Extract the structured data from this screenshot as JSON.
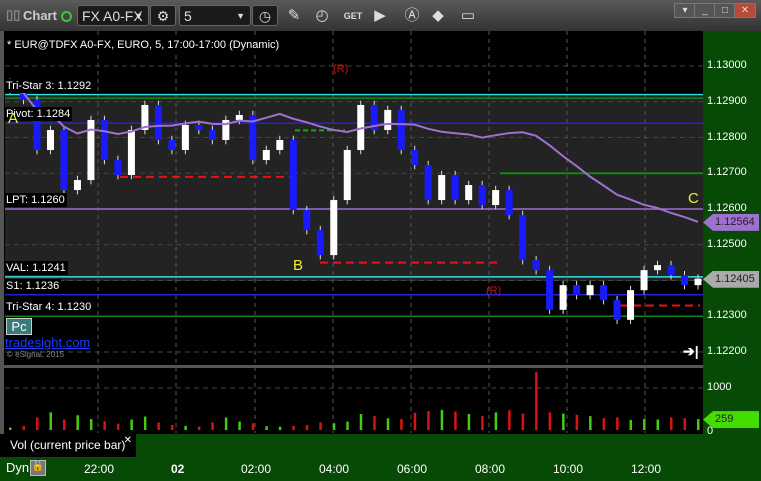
{
  "window": {
    "title": "Chart",
    "symbol": "FX A0-FX",
    "interval": "5"
  },
  "chart": {
    "header": "* EUR@TDFX A0-FX, EURO, 5, 17:00-17:00 (Dynamic)",
    "levels": [
      {
        "label": "Tri-Star 3: 1.1292",
        "price": 1.1292,
        "color": "#33e0e0"
      },
      {
        "label": "Pivot: 1.1284",
        "price": 1.1284,
        "color": "#2222dd"
      },
      {
        "label": "LPT: 1.1260",
        "price": 1.126,
        "color": "#9a6fd0"
      },
      {
        "label": "VAL: 1.1241",
        "price": 1.1241,
        "color": "#33e0e0"
      },
      {
        "label": "S1: 1.1236",
        "price": 1.1236,
        "color": "#2222dd"
      },
      {
        "label": "Tri-Star 4: 1.1230",
        "price": 1.123,
        "color": "#118811"
      }
    ],
    "pc_button": "Pc",
    "brand": "tradesight.com",
    "copyright": "© eSignal, 2015",
    "annotations": [
      "A",
      "B",
      "C",
      "(R)",
      "(R)"
    ],
    "closes": [
      1.12933,
      1.12905,
      1.12765,
      1.12821,
      1.12653,
      1.12681,
      1.12849,
      1.12737,
      1.12695,
      1.12821,
      1.12891,
      1.12793,
      1.12765,
      1.12835,
      1.12821,
      1.12793,
      1.12849,
      1.12863,
      1.12737,
      1.12765,
      1.12793,
      1.12597,
      1.12541,
      1.12471,
      1.12625,
      1.12765,
      1.12891,
      1.12821,
      1.12877,
      1.12765,
      1.12723,
      1.12625,
      1.12695,
      1.12625,
      1.12667,
      1.12611,
      1.12653,
      1.12583,
      1.12457,
      1.12429,
      1.12318,
      1.12387,
      1.12359,
      1.12387,
      1.12345,
      1.1229,
      1.12373,
      1.12429,
      1.12443,
      1.12415,
      1.12387,
      1.12405
    ],
    "volumes": [
      60,
      90,
      300,
      420,
      250,
      350,
      260,
      210,
      150,
      250,
      320,
      180,
      120,
      100,
      80,
      180,
      300,
      200,
      160,
      90,
      80,
      100,
      120,
      180,
      160,
      200,
      380,
      330,
      280,
      260,
      410,
      450,
      480,
      440,
      380,
      330,
      420,
      470,
      390,
      1380,
      420,
      390,
      360,
      330,
      280,
      300,
      240,
      260,
      250,
      300,
      280,
      259
    ],
    "price_axis": [
      "1.13000",
      "1.12900",
      "1.12800",
      "1.12700",
      "1.12600",
      "1.12500",
      "1.12300",
      "1.12200"
    ],
    "ma_tag": "1.12564",
    "last_tag": "1.12405",
    "vol_axis": [
      "1000",
      "0"
    ],
    "vol_tag": "259",
    "vol_study": "Vol (current price bar)",
    "time_axis": [
      "22:00",
      "02",
      "02:00",
      "04:00",
      "06:00",
      "08:00",
      "10:00",
      "12:00"
    ],
    "dyn": "Dyn",
    "colors": {
      "up": "#ffffff",
      "down": "#1a1aff",
      "ma": "#a070d0",
      "vol_up": "#44cc11",
      "vol_down": "#dd1111",
      "axis_bg": "#064a06"
    }
  }
}
